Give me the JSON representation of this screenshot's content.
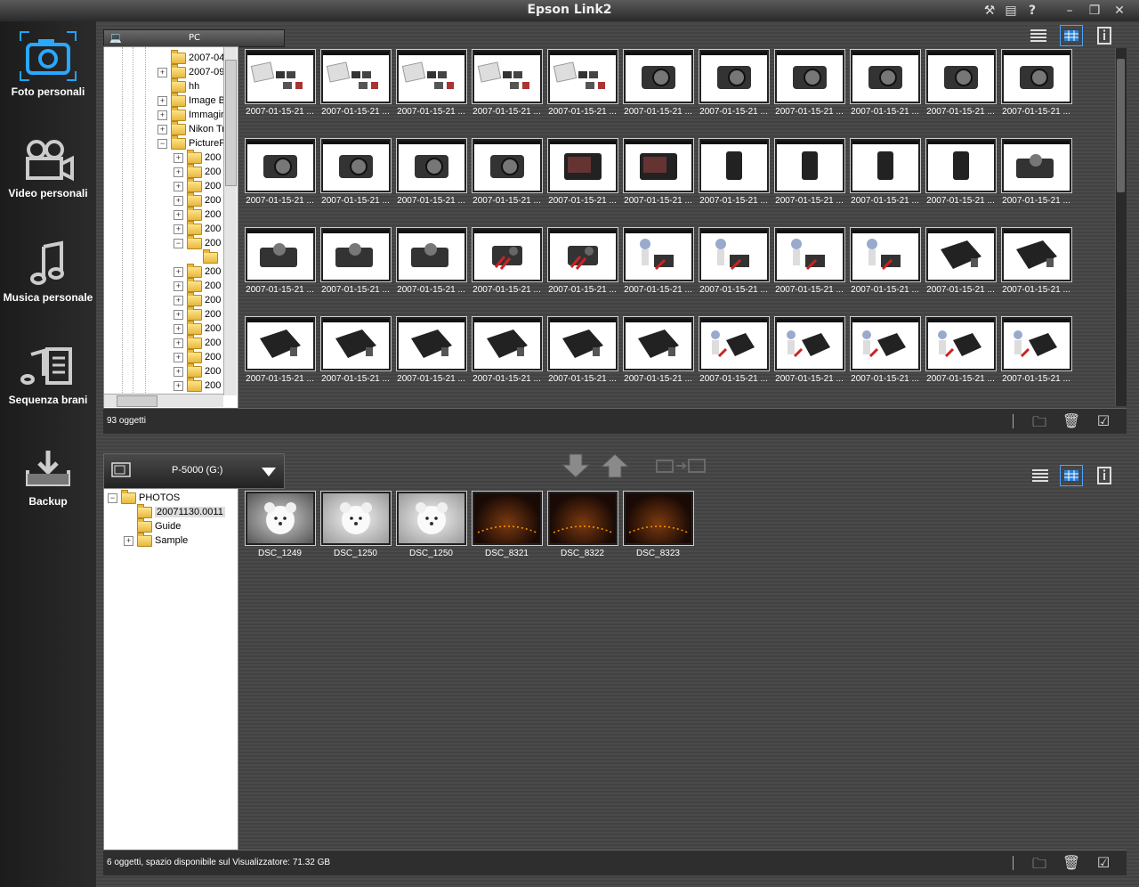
{
  "window": {
    "title": "Epson Link2"
  },
  "sidebar": {
    "items": [
      {
        "label": "Foto personali",
        "icon": "camera-icon",
        "active": true
      },
      {
        "label": "Video personali",
        "icon": "video-camera-icon"
      },
      {
        "label": "Musica personale",
        "icon": "music-note-icon"
      },
      {
        "label": "Sequenza brani",
        "icon": "playlist-icon"
      },
      {
        "label": "Backup",
        "icon": "backup-icon"
      }
    ]
  },
  "top": {
    "source_label": "PC",
    "tree": [
      {
        "label": "2007-04",
        "exp": ""
      },
      {
        "label": "2007-09",
        "exp": "+"
      },
      {
        "label": "hh",
        "exp": ""
      },
      {
        "label": "Image B",
        "exp": "+"
      },
      {
        "label": "Immagin",
        "exp": "+"
      },
      {
        "label": "Nikon Tr",
        "exp": "+"
      },
      {
        "label": "PictureP",
        "exp": "-"
      },
      {
        "label": "200",
        "exp": "+"
      },
      {
        "label": "200",
        "exp": "+"
      },
      {
        "label": "200",
        "exp": "+"
      },
      {
        "label": "200",
        "exp": "+"
      },
      {
        "label": "200",
        "exp": "+"
      },
      {
        "label": "200",
        "exp": "+"
      },
      {
        "label": "200",
        "exp": "-"
      },
      {
        "label": "",
        "exp": ""
      },
      {
        "label": "200",
        "exp": "+"
      },
      {
        "label": "200",
        "exp": "+"
      },
      {
        "label": "200",
        "exp": "+"
      },
      {
        "label": "200",
        "exp": "+"
      },
      {
        "label": "200",
        "exp": "+"
      },
      {
        "label": "200",
        "exp": "+"
      },
      {
        "label": "200",
        "exp": "+"
      },
      {
        "label": "200",
        "exp": "+"
      },
      {
        "label": "200",
        "exp": "+"
      }
    ],
    "thumb_caption": "2007-01-15-21 ...",
    "thumb_count": 44,
    "status": "93 oggetti"
  },
  "transfer": {
    "down": "arrow-down-icon",
    "up": "arrow-up-icon",
    "sync": "camera-to-device-icon"
  },
  "bottom": {
    "device": "P-5000 (G:)",
    "tree": [
      {
        "label": "PHOTOS",
        "exp": "-"
      },
      {
        "label": "20071130.0011",
        "exp": "",
        "selected": true
      },
      {
        "label": "Guide",
        "exp": ""
      },
      {
        "label": "Sample",
        "exp": "+"
      }
    ],
    "thumbs": [
      {
        "caption": "DSC_1249",
        "kind": "bear"
      },
      {
        "caption": "DSC_1250",
        "kind": "bear2"
      },
      {
        "caption": "DSC_1250",
        "kind": "bear2"
      },
      {
        "caption": "DSC_8321",
        "kind": "dark"
      },
      {
        "caption": "DSC_8322",
        "kind": "dark"
      },
      {
        "caption": "DSC_8323",
        "kind": "dark"
      }
    ],
    "status": "6 oggetti, spazio disponibile sul Visualizzatore: 71.32 GB"
  }
}
